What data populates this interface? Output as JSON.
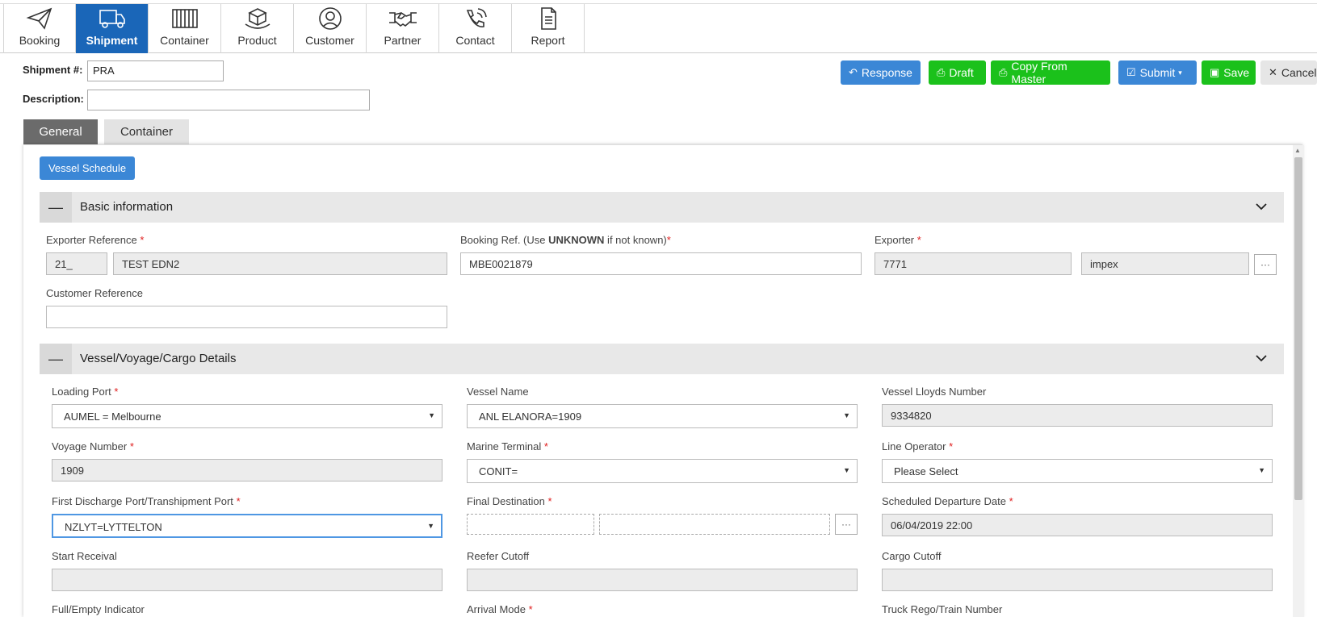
{
  "nav": [
    {
      "label": "Booking",
      "icon": "paper-plane-icon",
      "active": false
    },
    {
      "label": "Shipment",
      "icon": "truck-icon",
      "active": true
    },
    {
      "label": "Container",
      "icon": "container-icon",
      "active": false
    },
    {
      "label": "Product",
      "icon": "box-icon",
      "active": false
    },
    {
      "label": "Customer",
      "icon": "user-icon",
      "active": false
    },
    {
      "label": "Partner",
      "icon": "handshake-icon",
      "active": false
    },
    {
      "label": "Contact",
      "icon": "phone-icon",
      "active": false
    },
    {
      "label": "Report",
      "icon": "document-icon",
      "active": false
    }
  ],
  "header": {
    "shipment_label": "Shipment #:",
    "shipment_value": "PRA",
    "description_label": "Description:",
    "description_value": ""
  },
  "actions": {
    "response": "Response",
    "draft": "Draft",
    "copy_from_master": "Copy From Master",
    "submit": "Submit",
    "save": "Save",
    "cancel": "Cancel"
  },
  "tabs": {
    "general": "General",
    "container": "Container"
  },
  "vessel_schedule_button": "Vessel Schedule",
  "basic": {
    "title": "Basic information",
    "exporter_reference_label": "Exporter Reference",
    "exporter_reference_code": "21_",
    "exporter_reference_name": "TEST EDN2",
    "booking_ref_label_pre": "Booking Ref. (Use ",
    "booking_ref_label_bold": "UNKNOWN",
    "booking_ref_label_post": " if not known)",
    "booking_ref_value": "MBE0021879",
    "exporter_label": "Exporter",
    "exporter_code": "7771",
    "exporter_name": "impex",
    "customer_reference_label": "Customer Reference",
    "customer_reference_value": ""
  },
  "vessel": {
    "title": "Vessel/Voyage/Cargo Details",
    "loading_port_label": "Loading Port",
    "loading_port_value": "AUMEL = Melbourne",
    "vessel_name_label": "Vessel Name",
    "vessel_name_value": "ANL ELANORA=1909",
    "vessel_lloyds_label": "Vessel Lloyds Number",
    "vessel_lloyds_value": "9334820",
    "voyage_number_label": "Voyage Number",
    "voyage_number_value": "1909",
    "marine_terminal_label": "Marine Terminal",
    "marine_terminal_value": "CONIT=",
    "line_operator_label": "Line Operator",
    "line_operator_value": "Please Select",
    "first_discharge_label": "First Discharge Port/Transhipment Port",
    "first_discharge_value": "NZLYT=LYTTELTON",
    "final_destination_label": "Final Destination",
    "scheduled_departure_label": "Scheduled Departure Date",
    "scheduled_departure_value": "06/04/2019 22:00",
    "start_receival_label": "Start Receival",
    "reefer_cutoff_label": "Reefer Cutoff",
    "cargo_cutoff_label": "Cargo Cutoff",
    "full_empty_label": "Full/Empty Indicator",
    "arrival_mode_label": "Arrival Mode",
    "truck_rego_label": "Truck Rego/Train Number"
  },
  "required_mark": "*"
}
